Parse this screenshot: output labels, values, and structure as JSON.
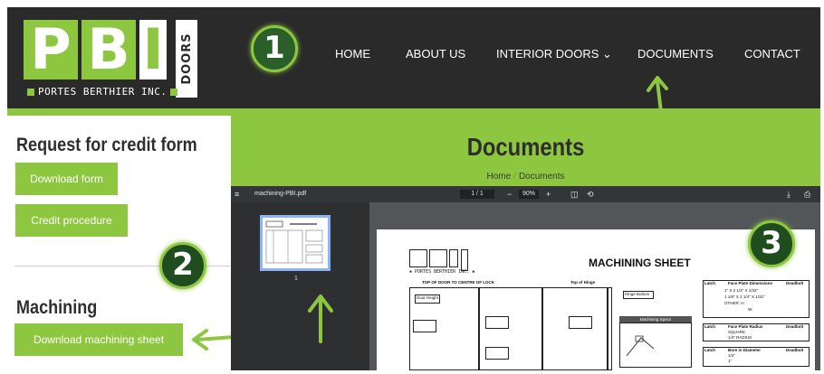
{
  "header": {
    "logo": {
      "letters": [
        "P",
        "B",
        "I"
      ],
      "side_text": "DOORS",
      "subtitle": "PORTES BERTHIER INC."
    },
    "nav": {
      "home": "HOME",
      "about": "ABOUT US",
      "interior": "INTERIOR DOORS ⌄",
      "documents": "DOCUMENTS",
      "contact": "CONTACT"
    }
  },
  "badges": {
    "one": "1",
    "two": "2",
    "three": "3"
  },
  "sidebar": {
    "credit_heading": "Request for credit form",
    "download_form": "Download form",
    "credit_procedure": "Credit procedure",
    "machining_heading": "Machining",
    "download_machining": "Download machining sheet"
  },
  "banner": {
    "title": "Documents",
    "breadcrumb_home": "Home",
    "breadcrumb_sep": "/",
    "breadcrumb_current": "Documents"
  },
  "pdf_viewer": {
    "menu_icon": "≡",
    "filename": "machining-PBI.pdf",
    "page_indicator": "1 / 1",
    "zoom_out": "−",
    "zoom": "90%",
    "zoom_in": "+",
    "fit_icon": "◫",
    "rotate_icon": "⟲",
    "download_icon": "⤓",
    "print_icon": "⎙",
    "thumbnail_page": "1",
    "sheet": {
      "title": "MACHINING SHEET",
      "logo_letters": [
        "P",
        "B",
        "I"
      ],
      "logo_sub": "▪ PORTES BERTHIER INC. ▪",
      "label_top": "TOP OF DOOR TO CENTRE OF LOCK",
      "label_hinge": "Top of Hinge",
      "label_hinge_bottom": "Hinge Bottom",
      "label_door_height": "Door Height",
      "label_options": "Machining Specs",
      "table1_head": [
        "Latch",
        "Face Plate Dimensions",
        "Deadbolt"
      ],
      "table1_rows": [
        "1\" X 2 1/4\" X 1/32\"",
        "1 1/8\" X 2 1/4\" X 1/32\"",
        "OTHER: H:",
        "W:"
      ],
      "table2_head": [
        "Latch",
        "Face Plate Radius",
        "Deadbolt"
      ],
      "table2_rows": [
        "SQUARE",
        "1/4\" RADIUS"
      ],
      "table3_head": [
        "Latch",
        "Bore in Diameter",
        "Deadbolt"
      ],
      "table3_rows": [
        "1/4\"",
        "1\""
      ]
    }
  },
  "colors": {
    "brand_green": "#8dc63f",
    "header_dark": "#2a2a2a",
    "badge_green": "#1f4d1f"
  }
}
